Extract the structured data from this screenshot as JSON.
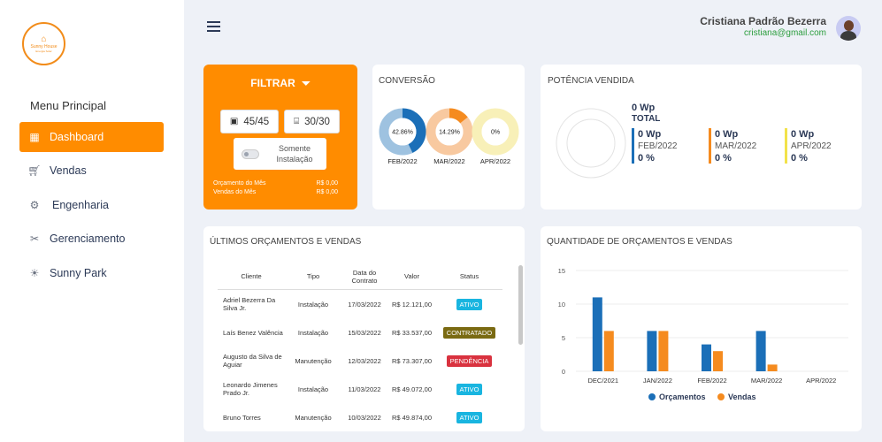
{
  "logo": {
    "name": "Sunny House",
    "tagline": "Energia Solar"
  },
  "sidebar": {
    "title": "Menu Principal",
    "items": [
      {
        "label": "Dashboard",
        "icon": "grid-icon",
        "active": true
      },
      {
        "label": "Vendas",
        "icon": "cart-icon",
        "active": false
      },
      {
        "label": "Engenharia",
        "icon": "gear-icon",
        "active": false
      },
      {
        "label": "Gerenciamento",
        "icon": "tools-icon",
        "active": false
      },
      {
        "label": "Sunny Park",
        "icon": "sun-icon",
        "active": false
      }
    ]
  },
  "header": {
    "user_name": "Cristiana Padrão Bezerra",
    "user_email": "cristiana@gmail.com"
  },
  "filter": {
    "title": "FILTRAR",
    "count_a": "45/45",
    "count_b": "30/30",
    "toggle_label": "Somente Instalação",
    "orcamento_label": "Orçamento do Mês",
    "orcamento_value": "R$ 0,00",
    "vendas_label": "Vendas do Mês",
    "vendas_value": "R$ 0,00"
  },
  "conversao": {
    "title": "CONVERSÃO",
    "donuts": [
      {
        "label": "FEB/2022",
        "percent": 42.86,
        "text": "42.86%",
        "color": "#1b6fb8",
        "track": "#9ec2e0"
      },
      {
        "label": "MAR/2022",
        "percent": 14.29,
        "text": "14.29%",
        "color": "#f58b1f",
        "track": "#f8c9a0"
      },
      {
        "label": "APR/2022",
        "percent": 0,
        "text": "0%",
        "color": "#e9d94a",
        "track": "#f8f0b8"
      }
    ]
  },
  "potencia": {
    "title": "POTÊNCIA VENDIDA",
    "total_value": "0 Wp",
    "total_label": "TOTAL",
    "months": [
      {
        "value": "0 Wp",
        "label": "FEB/2022",
        "pct": "0 %",
        "color": "#1b6fb8"
      },
      {
        "value": "0 Wp",
        "label": "MAR/2022",
        "pct": "0 %",
        "color": "#f58b1f"
      },
      {
        "value": "0 Wp",
        "label": "APR/2022",
        "pct": "0 %",
        "color": "#f2e24a"
      }
    ]
  },
  "table": {
    "title": "ÚLTIMOS ORÇAMENTOS E VENDAS",
    "headers": [
      "Cliente",
      "Tipo",
      "Data do Contrato",
      "Valor",
      "Status"
    ],
    "rows": [
      {
        "cliente": "Adriel Bezerra Da Silva Jr.",
        "tipo": "Instalação",
        "data": "17/03/2022",
        "valor": "R$ 12.121,00",
        "status": "ATIVO",
        "status_color": "#19b5e0"
      },
      {
        "cliente": "Laís Benez Valência",
        "tipo": "Instalação",
        "data": "15/03/2022",
        "valor": "R$ 33.537,00",
        "status": "CONTRATADO",
        "status_color": "#7a6a12"
      },
      {
        "cliente": "Augusto da Silva de Aguiar",
        "tipo": "Manutenção",
        "data": "12/03/2022",
        "valor": "R$ 73.307,00",
        "status": "PENDÊNCIA",
        "status_color": "#d9323f"
      },
      {
        "cliente": "Leonardo Jimenes Prado Jr.",
        "tipo": "Instalação",
        "data": "11/03/2022",
        "valor": "R$ 49.072,00",
        "status": "ATIVO",
        "status_color": "#19b5e0"
      },
      {
        "cliente": "Bruno Torres",
        "tipo": "Manutenção",
        "data": "10/03/2022",
        "valor": "R$ 49.874,00",
        "status": "ATIVO",
        "status_color": "#19b5e0"
      }
    ]
  },
  "chart_title": "QUANTIDADE DE ORÇAMENTOS E VENDAS",
  "chart_data": {
    "type": "bar",
    "categories": [
      "DEC/2021",
      "JAN/2022",
      "FEB/2022",
      "MAR/2022",
      "APR/2022"
    ],
    "series": [
      {
        "name": "Orçamentos",
        "values": [
          11,
          6,
          4,
          6,
          0
        ],
        "color": "#1b6fb8"
      },
      {
        "name": "Vendas",
        "values": [
          6,
          6,
          3,
          1,
          0
        ],
        "color": "#f58b1f"
      }
    ],
    "yticks": [
      0,
      5,
      10,
      15
    ],
    "ylim": [
      0,
      15
    ],
    "legend": "bottom"
  }
}
